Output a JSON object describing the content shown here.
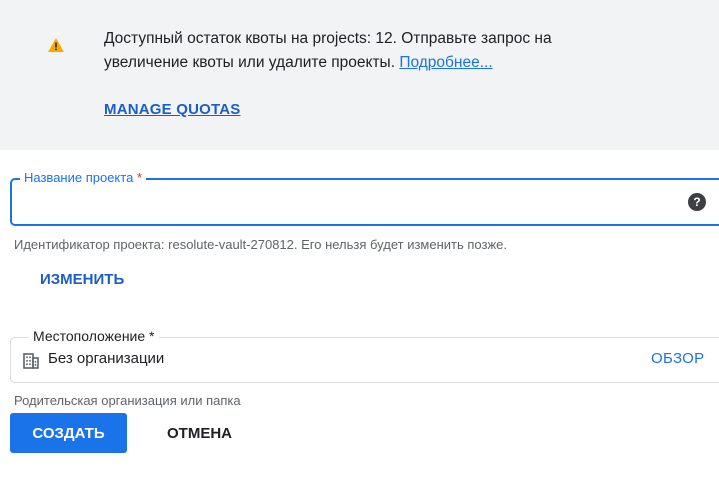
{
  "banner": {
    "line1": "Доступный остаток квоты на projects: 12. Отправьте запрос на",
    "line2": "увеличение квоты или удалите проекты.",
    "learn_more": "Подробнее...",
    "manage_quotas": "MANAGE QUOTAS",
    "icon": "warning-icon",
    "icon_color": "#f9ab00"
  },
  "project_name": {
    "label": "Название проекта",
    "required_mark": "*",
    "value": "",
    "help_icon": "?",
    "hint": "Идентификатор проекта: resolute-vault-270812. Его нельзя будет изменить позже.",
    "change_label": "ИЗМЕНИТЬ"
  },
  "location": {
    "label": "Местоположение *",
    "icon": "building-icon",
    "value": "Без организации",
    "browse_label": "ОБЗОР",
    "hint": "Родительская организация или папка"
  },
  "actions": {
    "create_label": "СОЗДАТЬ",
    "cancel_label": "ОТМЕНА"
  },
  "colors": {
    "accent": "#1a73e8",
    "banner_bg": "#f1f3f4",
    "required": "#d93025"
  }
}
